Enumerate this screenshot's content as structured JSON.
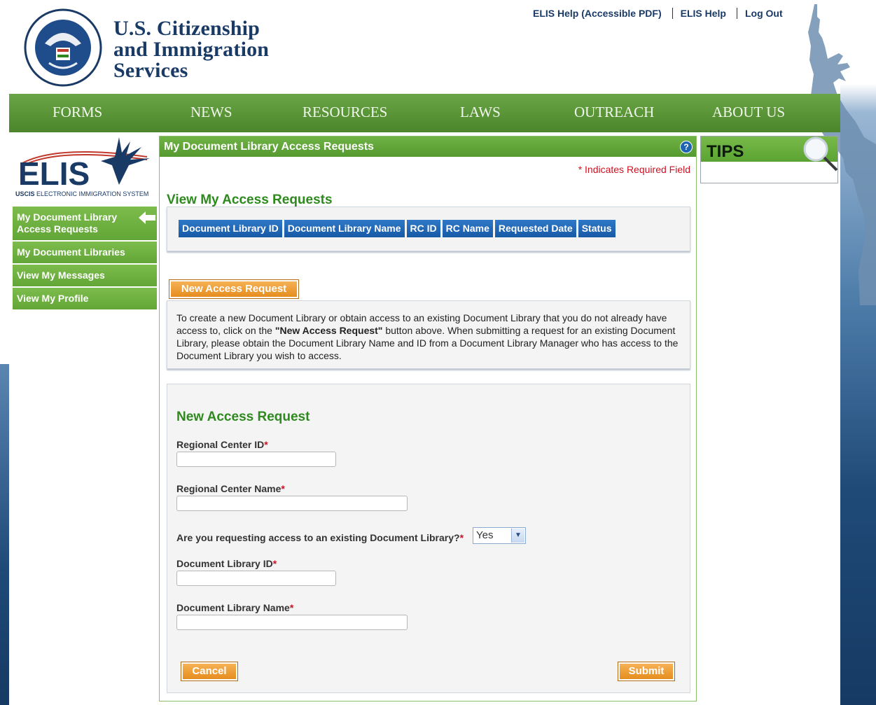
{
  "header": {
    "agency_lines": [
      "U.S. Citizenship",
      "and Immigration",
      "Services"
    ],
    "seal_alt": "Department of Homeland Security seal",
    "links": [
      {
        "label": "ELIS Help (Accessible PDF)"
      },
      {
        "label": "ELIS Help"
      },
      {
        "label": "Log Out"
      }
    ]
  },
  "nav": {
    "items": [
      "FORMS",
      "NEWS",
      "RESOURCES",
      "LAWS",
      "OUTREACH",
      "ABOUT US"
    ]
  },
  "sidebar": {
    "logo_text": "ELIS",
    "logo_subtext_bold": "USCIS",
    "logo_subtext": "ELECTRONIC IMMIGRATION SYSTEM",
    "items": [
      {
        "label": "My Document Library Access Requests",
        "active": true
      },
      {
        "label": "My Document Libraries"
      },
      {
        "label": "View My Messages"
      },
      {
        "label": "View My Profile"
      }
    ]
  },
  "main": {
    "panel_title": "My Document Library Access Requests",
    "help_icon": "?",
    "required_note": "* Indicates Required Field",
    "view_title": "View My Access Requests",
    "table_headers": [
      "Document Library ID",
      "Document Library Name",
      "RC ID",
      "RC Name",
      "Requested Date",
      "Status"
    ],
    "new_request_button": "New Access Request",
    "info_pre": "To create a new Document Library or obtain access to an existing Document Library that you do not already have access to, click on the ",
    "info_bold": "\"New Access Request\"",
    "info_post": " button above. When submitting a request for an existing Document Library, please obtain the Document Library Name and ID from a Document Library Manager who has access to the Document Library you wish to access.",
    "form": {
      "title": "New Access Request",
      "rc_id_label": "Regional Center ID",
      "rc_name_label": "Regional Center Name",
      "existing_question": "Are you requesting access to an existing Document Library?",
      "existing_value": "Yes",
      "dl_id_label": "Document Library ID",
      "dl_name_label": "Document Library Name",
      "required_mark": "*",
      "cancel_label": "Cancel",
      "submit_label": "Submit"
    }
  },
  "tips": {
    "title": "TIPS"
  },
  "colors": {
    "nav_green": "#5a9638",
    "section_green": "#2e8a1e",
    "table_blue": "#1f63b4",
    "button_orange": "#e48a19",
    "required_red": "#cc1122"
  }
}
